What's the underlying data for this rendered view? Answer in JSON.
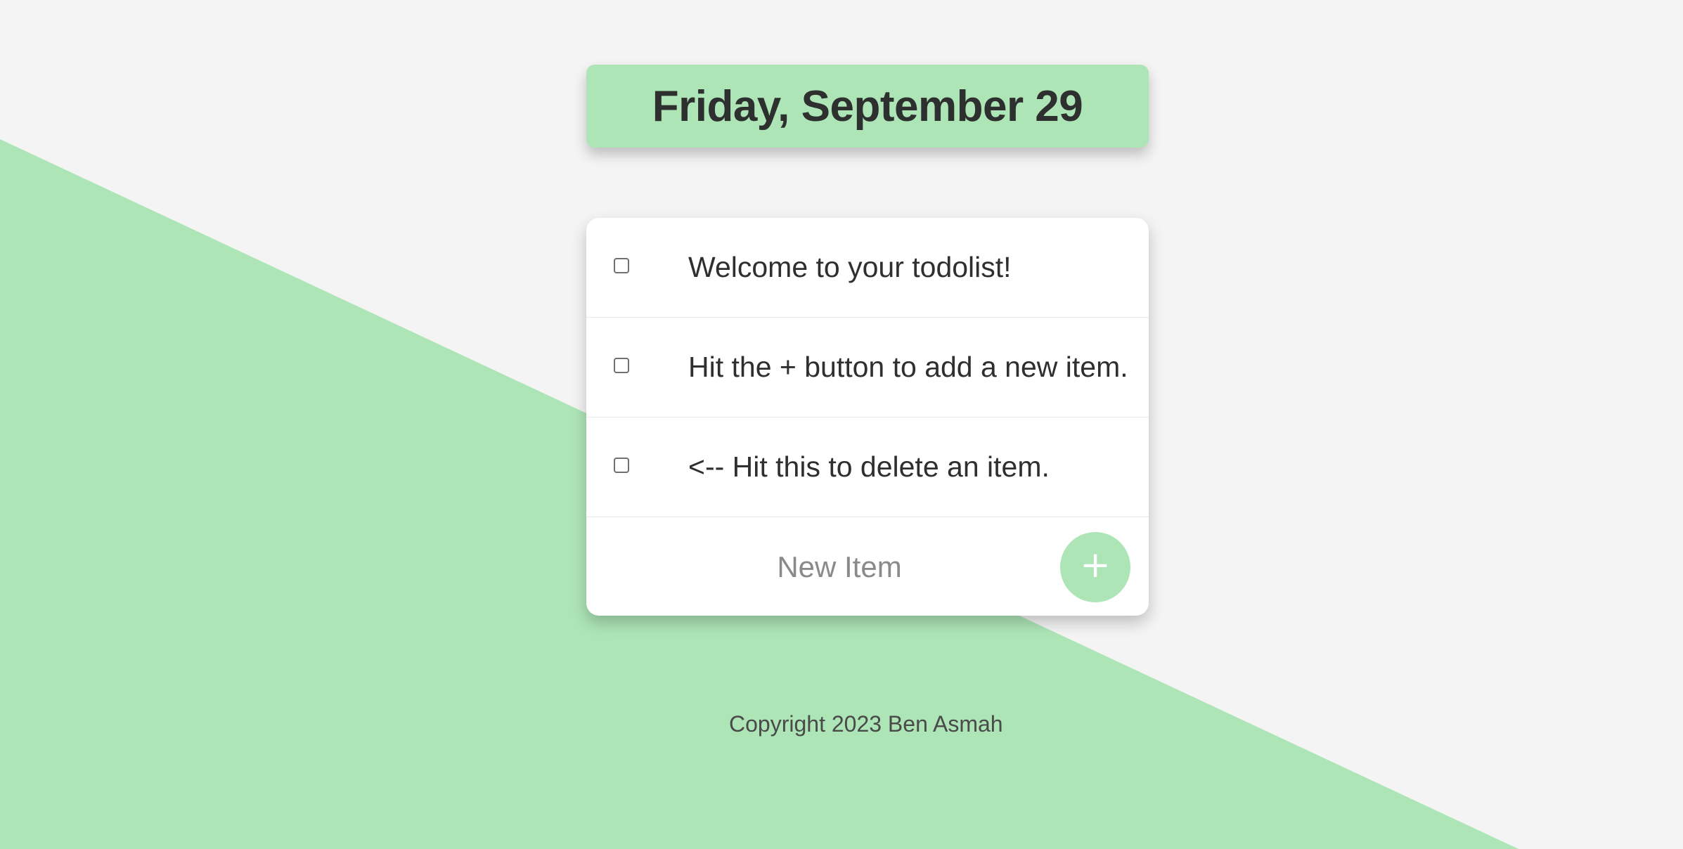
{
  "colors": {
    "background": "#f4f4f4",
    "accent_green": "#ade5b6",
    "heading_text": "#2e302f",
    "card_background": "#ffffff",
    "button_icon": "#ffffff"
  },
  "header": {
    "date_title": "Friday, September 29"
  },
  "todo_list": {
    "items": [
      {
        "label": "Welcome to your todolist!",
        "checked": false
      },
      {
        "label": "Hit the + button to add a new item.",
        "checked": false
      },
      {
        "label": "<-- Hit this to delete an item.",
        "checked": false
      }
    ],
    "new_item": {
      "placeholder": "New Item",
      "value": ""
    },
    "add_button": {
      "label": "+",
      "icon": "plus-icon"
    }
  },
  "footer": {
    "copyright": "Copyright 2023 Ben Asmah"
  }
}
